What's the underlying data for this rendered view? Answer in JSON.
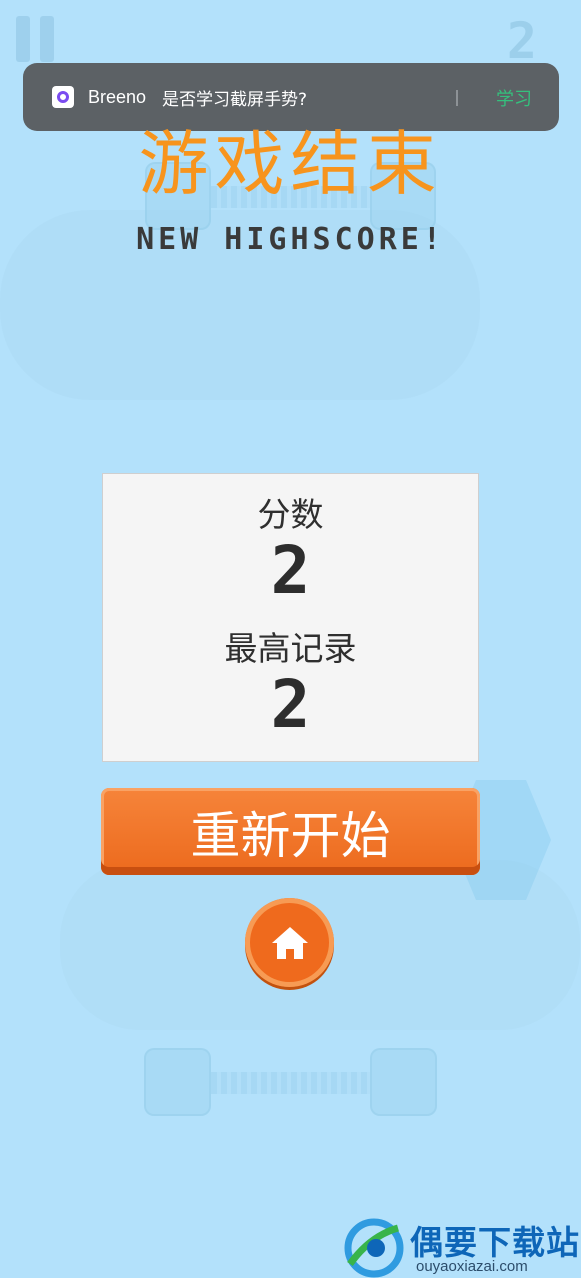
{
  "notification": {
    "app": "Breeno",
    "message": "是否学习截屏手势?",
    "action": "学习"
  },
  "hud": {
    "score": "2"
  },
  "title": "游戏结束",
  "subtitle": "NEW HIGHSCORE!",
  "panel": {
    "score_label": "分数",
    "score_value": "2",
    "best_label": "最高记录",
    "best_value": "2"
  },
  "buttons": {
    "restart": "重新开始"
  },
  "watermark": {
    "title": "偶要下载站",
    "url": "ouyaoxiazai.com"
  },
  "colors": {
    "background": "#b3e1fb",
    "title": "#f7941d",
    "button": "#ec6a1d",
    "notification_bg": "#5c6165",
    "notification_action": "#35c07d"
  },
  "icons": [
    "pause-icon",
    "breeno-icon",
    "home-icon",
    "watermark-logo-icon"
  ]
}
